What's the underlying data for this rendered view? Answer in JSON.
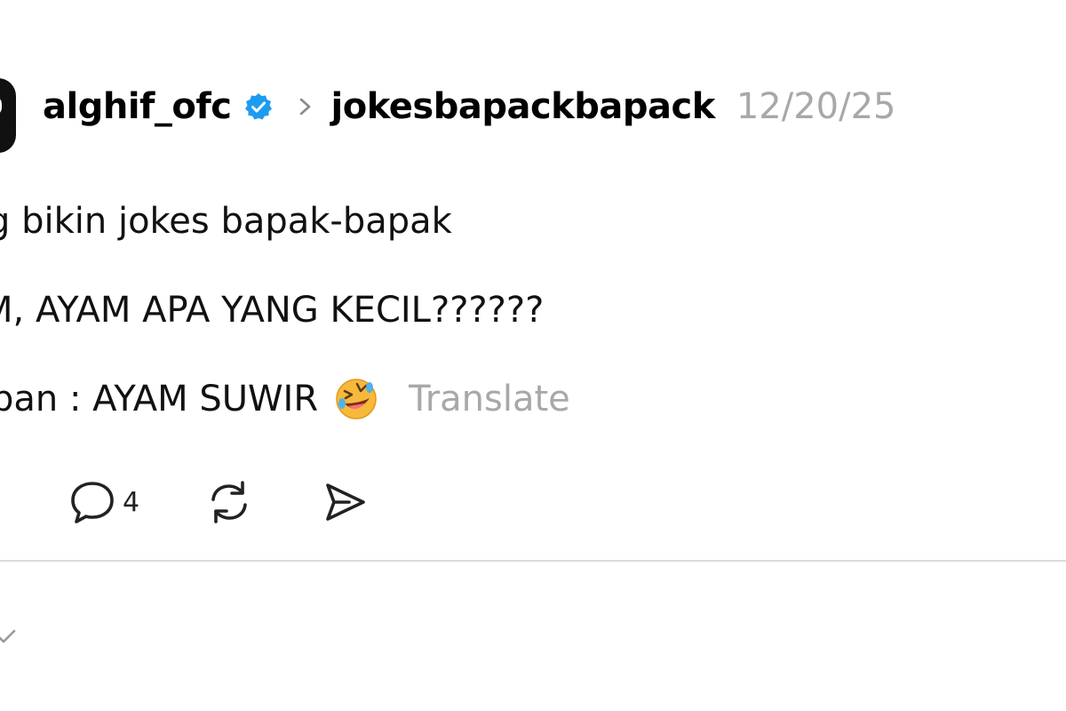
{
  "post": {
    "username": "alghif_ofc",
    "community": "jokesbapackbapack",
    "timestamp": "12/20/25",
    "lines": [
      "g bikin jokes bapak-bapak",
      "M, AYAM APA YANG KECIL??????",
      "ban : AYAM SUWIR"
    ],
    "emoji": "rolling-on-floor-laughing-emoji",
    "translate_label": "Translate"
  },
  "actions": {
    "reply_count": "4"
  },
  "icons": {
    "verified": "verified-badge-icon",
    "reply": "comment-bubble-icon",
    "repost": "repost-icon",
    "share": "send-icon"
  },
  "colors": {
    "verified_blue": "#1d9bf0",
    "muted_text": "#a8a8a8",
    "divider": "#dcdcdc"
  }
}
